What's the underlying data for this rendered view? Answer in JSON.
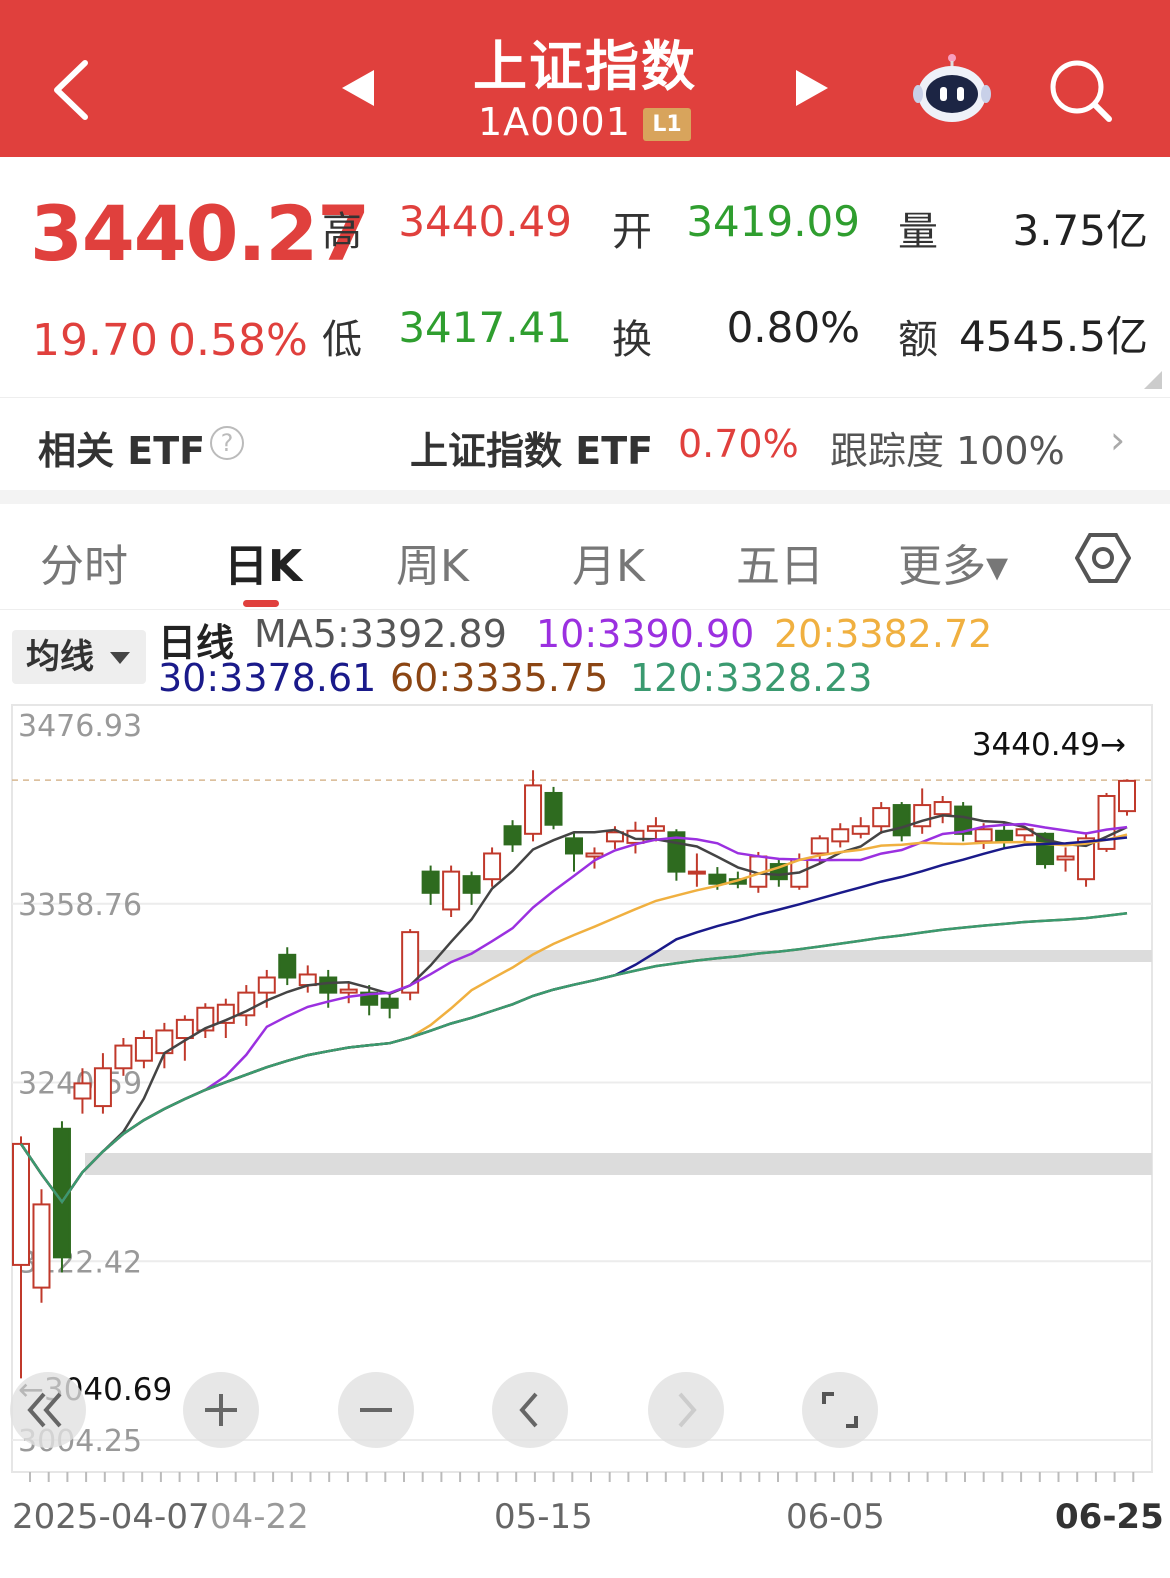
{
  "header": {
    "title": "上证指数",
    "code": "1A0001",
    "level": "L1"
  },
  "quote": {
    "price": "3440.27",
    "change": "19.70",
    "change_pct": "0.58%",
    "high_label": "高",
    "high": "3440.49",
    "open_label": "开",
    "open": "3419.09",
    "volume_label": "量",
    "volume": "3.75亿",
    "low_label": "低",
    "low": "3417.41",
    "turnover_label": "换",
    "turnover": "0.80%",
    "amount_label": "额",
    "amount": "4545.5亿"
  },
  "etf": {
    "label": "相关 ETF",
    "help": "?",
    "name": "上证指数 ETF",
    "pct": "0.70%",
    "track": "跟踪度 100%",
    "arrow": "›"
  },
  "tabs": [
    {
      "label": "分时"
    },
    {
      "label": "日K"
    },
    {
      "label": "周K"
    },
    {
      "label": "月K"
    },
    {
      "label": "五日"
    },
    {
      "label": "更多▾"
    }
  ],
  "ma": {
    "select": "均线",
    "line_label": "日线",
    "ma5": "MA5:3392.89",
    "ma10": "10:3390.90",
    "ma20": "20:3382.72",
    "ma30": "30:3378.61",
    "ma60": "60:3335.75",
    "ma120": "120:3328.23"
  },
  "colors": {
    "up": "#c0392b",
    "down": "#2e6b1f",
    "ma5": "#444444",
    "ma10": "#9b30e0",
    "ma20": "#f0b040",
    "ma30": "#1a1a8a",
    "ma60": "#8b4513",
    "ma120": "#3a9a70"
  },
  "chart_data": {
    "type": "candlestick",
    "y_ticks": [
      "3476.93",
      "3358.76",
      "3240.59",
      "3122.42",
      "3004.25"
    ],
    "ylim": [
      3004.25,
      3476.93
    ],
    "max_marker": "3440.49→",
    "min_marker": "←3040.69",
    "x_labels": [
      "2025-04-07",
      "04-22",
      "05-15",
      "06-05",
      "06-25"
    ],
    "candles": [
      [
        3120,
        3200,
        3045,
        3205
      ],
      [
        3105,
        3160,
        3095,
        3170
      ],
      [
        3210,
        3125,
        3115,
        3215
      ],
      [
        3230,
        3240,
        3220,
        3250
      ],
      [
        3225,
        3250,
        3220,
        3260
      ],
      [
        3250,
        3265,
        3245,
        3270
      ],
      [
        3255,
        3270,
        3250,
        3275
      ],
      [
        3260,
        3275,
        3250,
        3280
      ],
      [
        3270,
        3282,
        3255,
        3285
      ],
      [
        3275,
        3290,
        3270,
        3293
      ],
      [
        3280,
        3292,
        3270,
        3296
      ],
      [
        3285,
        3300,
        3278,
        3305
      ],
      [
        3300,
        3310,
        3290,
        3315
      ],
      [
        3325,
        3310,
        3305,
        3330
      ],
      [
        3305,
        3312,
        3300,
        3318
      ],
      [
        3310,
        3300,
        3290,
        3315
      ],
      [
        3300,
        3302,
        3293,
        3306
      ],
      [
        3300,
        3292,
        3285,
        3305
      ],
      [
        3296,
        3290,
        3283,
        3300
      ],
      [
        3300,
        3340,
        3295,
        3342
      ],
      [
        3380,
        3366,
        3358,
        3384
      ],
      [
        3355,
        3380,
        3350,
        3384
      ],
      [
        3377,
        3366,
        3358,
        3380
      ],
      [
        3375,
        3392,
        3370,
        3396
      ],
      [
        3410,
        3398,
        3393,
        3414
      ],
      [
        3405,
        3437,
        3400,
        3447
      ],
      [
        3432,
        3411,
        3408,
        3436
      ],
      [
        3402,
        3392,
        3380,
        3406
      ],
      [
        3390,
        3392,
        3382,
        3396
      ],
      [
        3400,
        3406,
        3395,
        3410
      ],
      [
        3399,
        3407,
        3392,
        3413
      ],
      [
        3407,
        3410,
        3400,
        3416
      ],
      [
        3406,
        3380,
        3374,
        3408
      ],
      [
        3380,
        3380,
        3370,
        3392
      ],
      [
        3378,
        3372,
        3368,
        3383
      ],
      [
        3375,
        3372,
        3369,
        3380
      ],
      [
        3370,
        3390,
        3366,
        3393
      ],
      [
        3385,
        3375,
        3370,
        3388
      ],
      [
        3370,
        3388,
        3368,
        3392
      ],
      [
        3392,
        3402,
        3386,
        3404
      ],
      [
        3400,
        3408,
        3396,
        3412
      ],
      [
        3405,
        3410,
        3402,
        3416
      ],
      [
        3410,
        3422,
        3405,
        3426
      ],
      [
        3424,
        3404,
        3400,
        3426
      ],
      [
        3410,
        3424,
        3405,
        3435
      ],
      [
        3418,
        3426,
        3412,
        3430
      ],
      [
        3423,
        3405,
        3400,
        3426
      ],
      [
        3400,
        3408,
        3395,
        3412
      ],
      [
        3407,
        3400,
        3396,
        3412
      ],
      [
        3404,
        3408,
        3400,
        3410
      ],
      [
        3405,
        3385,
        3382,
        3406
      ],
      [
        3388,
        3390,
        3380,
        3396
      ],
      [
        3375,
        3402,
        3370,
        3406
      ],
      [
        3395,
        3430,
        3393,
        3432
      ],
      [
        3420,
        3440,
        3417,
        3441
      ]
    ],
    "series": [
      {
        "name": "MA5"
      },
      {
        "name": "10"
      },
      {
        "name": "20"
      },
      {
        "name": "30"
      },
      {
        "name": "60"
      },
      {
        "name": "120"
      }
    ]
  }
}
